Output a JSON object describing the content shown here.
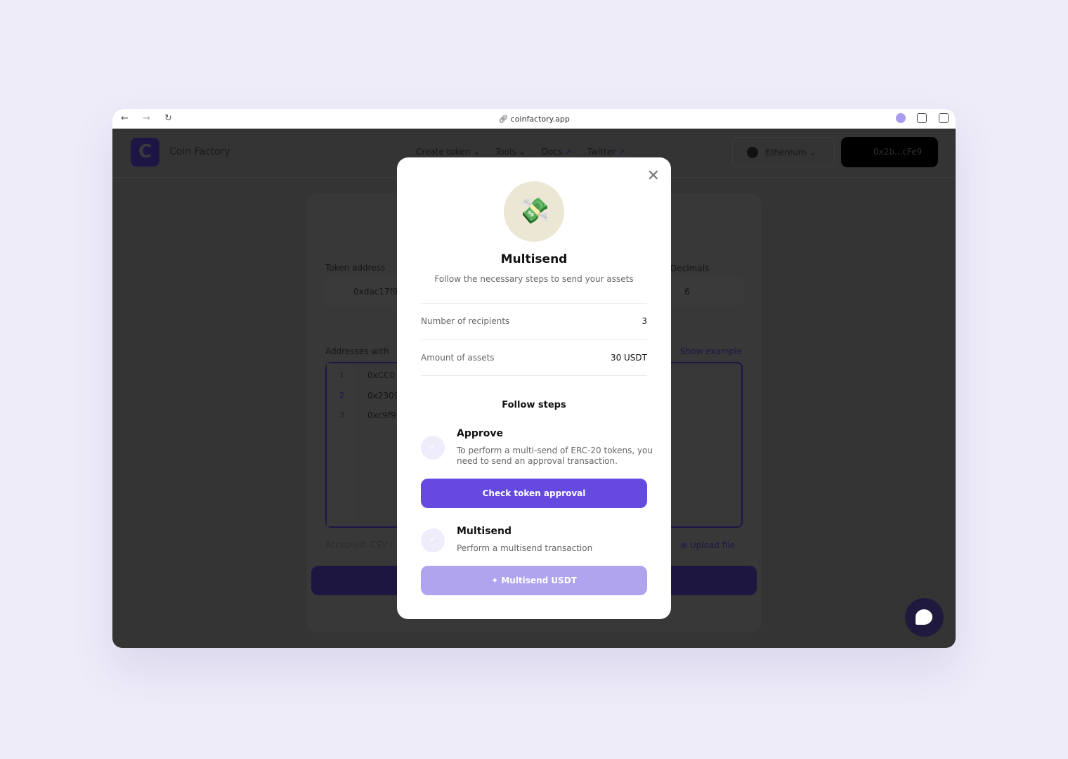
{
  "browser": {
    "url": "coinfactory.app"
  },
  "header": {
    "logo_letter": "C",
    "brand": "Coin Factory",
    "menu": [
      {
        "label": "Create token",
        "suffix": "⌄"
      },
      {
        "label": "Tools",
        "suffix": "⌄"
      },
      {
        "label": "Docs",
        "suffix": "↗"
      },
      {
        "label": "Twitter",
        "suffix": "↗"
      }
    ],
    "network": "Ethereum",
    "wallet": "0x2b...cFe9"
  },
  "form": {
    "token_address_label": "Token address",
    "token_address_value": "0xdac17f9",
    "decimals_label": "Decimals",
    "decimals_value": "6",
    "addresses_label": "Addresses with",
    "show_example": "Show example",
    "lines": [
      {
        "n": "1",
        "addr": "0xCC0"
      },
      {
        "n": "2",
        "addr": "0x2309"
      },
      {
        "n": "3",
        "addr": "0xc9f9"
      }
    ],
    "accepted": "Accepted: CSV /",
    "upload": "Upload file"
  },
  "modal": {
    "title": "Multisend",
    "subtitle": "Follow the necessary steps to send your assets",
    "recipients_label": "Number of recipients",
    "recipients_value": "3",
    "amount_label": "Amount of assets",
    "amount_value": "30 USDT",
    "steps_title": "Follow steps",
    "steps": [
      {
        "title": "Approve",
        "desc": "To perform a multi-send of ERC-20 tokens, you need to send an approval transaction.",
        "button": "Check token approval"
      },
      {
        "title": "Multisend",
        "desc": "Perform a multisend transaction",
        "button": "Multisend USDT"
      }
    ]
  },
  "colors": {
    "accent": "#6549e0",
    "accent_disabled": "#b0a4ee",
    "overlay": "#343434"
  }
}
